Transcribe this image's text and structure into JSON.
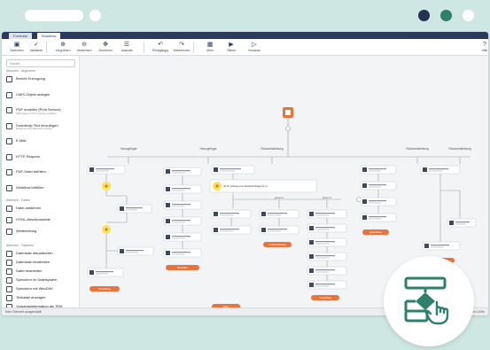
{
  "window": {
    "dots": [
      {
        "name": "dot-navy",
        "color": "#24314f"
      },
      {
        "name": "dot-green",
        "color": "#2f7f6d"
      },
      {
        "name": "dot-white",
        "color": "#ffffff"
      }
    ]
  },
  "tabs": [
    {
      "label": "Formular"
    },
    {
      "label": "Workflow"
    }
  ],
  "ribbon": [
    {
      "icon": "save-icon",
      "glyph": "▣",
      "label": "Speichern"
    },
    {
      "icon": "validate-icon",
      "glyph": "✓",
      "label": "Validieren"
    },
    {
      "icon": "zoom-in-icon",
      "glyph": "⊕",
      "label": "Vergrößern"
    },
    {
      "icon": "zoom-out-icon",
      "glyph": "⊖",
      "label": "Verkleinern"
    },
    {
      "icon": "center-icon",
      "glyph": "✥",
      "label": "Zentrieren"
    },
    {
      "icon": "selection-icon",
      "glyph": "☰",
      "label": "Auswahl"
    },
    {
      "icon": "undo-icon",
      "glyph": "↶",
      "label": "Rückgängig"
    },
    {
      "icon": "redo-icon",
      "glyph": "↷",
      "label": "Wiederholen"
    },
    {
      "icon": "grid-icon",
      "glyph": "▦",
      "label": "Mehr"
    },
    {
      "icon": "open-icon",
      "glyph": "▶",
      "label": "Öffnen"
    },
    {
      "icon": "preview-icon",
      "glyph": "▷",
      "label": "Vorschau"
    },
    {
      "icon": "help-icon",
      "glyph": "?",
      "label": "Hilfe"
    }
  ],
  "sidebar": {
    "search_placeholder": "Suche...",
    "section_general": "Aktionen - Allgemein",
    "section_data": "Aktionen - Daten",
    "section_systems": "Aktionen - Systeme",
    "items_general": [
      {
        "icon": "report-icon",
        "label": "Bericht Erzeugung",
        "sub": ""
      },
      {
        "icon": "cmis-icon",
        "label": "CMIS-Objekt anlegen",
        "sub": ""
      },
      {
        "icon": "print-icon",
        "label": "PDF erstellen (Print Service)",
        "sub": "PDF-Datei mit Print Service erstellen"
      },
      {
        "icon": "doc-icon",
        "label": "Doubleclip Text hinzufügen",
        "sub": "Dokument-Text-Element erstellen"
      },
      {
        "icon": "mail-icon",
        "label": "E-Mail",
        "sub": ""
      },
      {
        "icon": "http-icon",
        "label": "HTTP-Request",
        "sub": ""
      },
      {
        "icon": "pdf-icon",
        "label": "PDF-Datei befüllen",
        "sub": ""
      },
      {
        "icon": "workflow-icon",
        "label": "Workflow befüllen",
        "sub": ""
      }
    ],
    "items_data": [
      {
        "icon": "data-icon",
        "label": "Datei ausführen",
        "sub": ""
      },
      {
        "icon": "html-icon",
        "label": "HTML-Abschlussseite",
        "sub": ""
      },
      {
        "icon": "redirect-icon",
        "label": "Weiterleitung",
        "sub": ""
      }
    ],
    "items_systems": [
      {
        "icon": "wand-icon",
        "label": "Datensatz aktualisieren",
        "sub": ""
      },
      {
        "icon": "wand2-icon",
        "label": "Datensatz bearbeiten",
        "sub": ""
      },
      {
        "icon": "edit-icon",
        "label": "Datei bearbeiten",
        "sub": ""
      },
      {
        "icon": "storage-icon",
        "label": "Speichern im Dateisystem",
        "sub": ""
      },
      {
        "icon": "cloud-icon",
        "label": "Speichern mit WebDAV",
        "sub": ""
      },
      {
        "icon": "text-icon",
        "label": "Textdatei anzeigen",
        "sub": ""
      },
      {
        "icon": "archive-icon",
        "label": "Vorgangsinformation als TEM",
        "sub": ""
      }
    ]
  },
  "canvas": {
    "lane_titles": [
      "Hinzugefügte",
      "Hinzugefügte",
      "Rückmeldeleitung",
      "Rückmeldeleitung",
      "Rückmeldeleitung"
    ],
    "branch_labels": [
      "gruen 1",
      "gruen 2"
    ],
    "condition_text": "Ist zu Antrag eine Ersatzanfrage(n) in ...",
    "pill_labels": [
      "Erstellung",
      "Erstellen",
      "In Bearbeitung",
      "Vorschlag",
      "Abschluss",
      "Abschluss",
      "Start"
    ]
  },
  "status": {
    "left": "Kein Element ausgewählt",
    "right": "Vergrößern 100%"
  },
  "colors": {
    "accent": "#e8743b",
    "navy": "#2b3a5c",
    "badge_green": "#2f7f6d"
  }
}
